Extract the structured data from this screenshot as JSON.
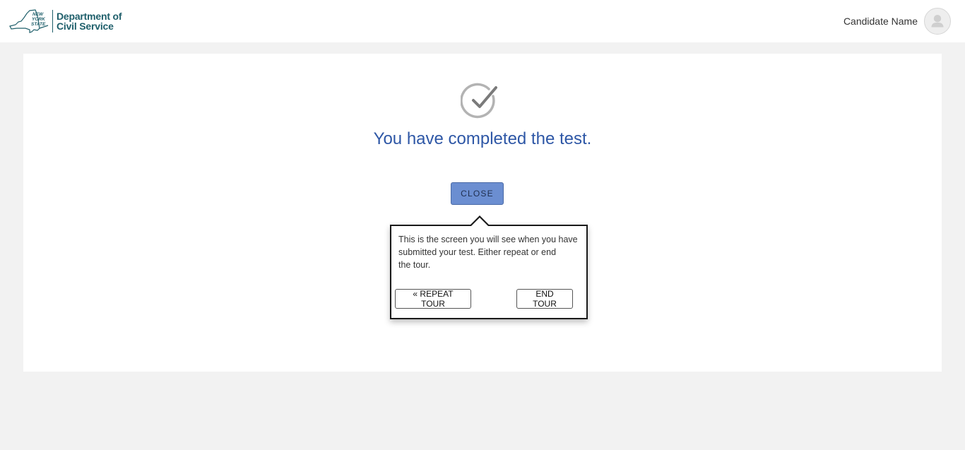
{
  "header": {
    "logo": {
      "state_lines": [
        "NEW",
        "YORK",
        "STATE"
      ],
      "org_lines": [
        "Department of",
        "Civil Service"
      ]
    },
    "user": {
      "name": "Candidate Name",
      "avatar_icon": "user-avatar-icon"
    }
  },
  "main": {
    "status_icon": "check-circle-icon",
    "title": "You have completed the test.",
    "close_label": "CLOSE"
  },
  "tour": {
    "lines": [
      "This is the screen you will see when you have",
      "submitted your test. Either repeat or end",
      "the tour."
    ],
    "repeat_label": "« REPEAT TOUR",
    "end_label": "END TOUR"
  },
  "colors": {
    "brand": "#1f5f6b",
    "title": "#2e57a6",
    "close_button": "#6b8ed1",
    "page_background": "#f2f2f2"
  }
}
